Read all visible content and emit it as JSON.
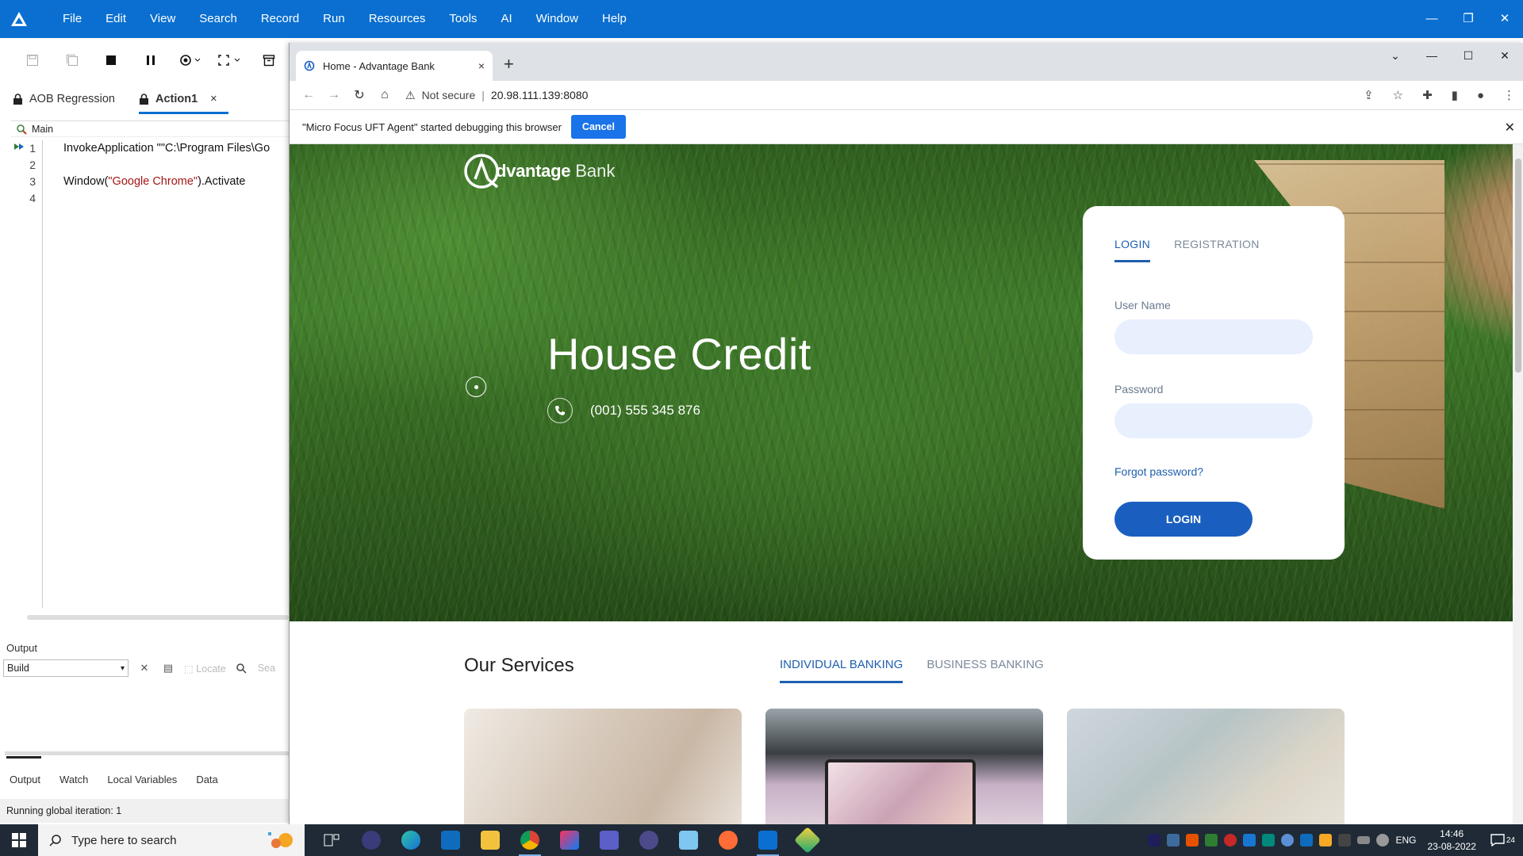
{
  "uft": {
    "menu": [
      "File",
      "Edit",
      "View",
      "Search",
      "Record",
      "Run",
      "Resources",
      "Tools",
      "AI",
      "Window",
      "Help"
    ],
    "doc_tabs": [
      {
        "label": "AOB Regression",
        "active": false
      },
      {
        "label": "Action1",
        "active": true,
        "close": "×"
      }
    ],
    "editor": {
      "breadcrumb": "Main",
      "line_numbers": [
        "1",
        "2",
        "3",
        "4"
      ],
      "line1_prefix": "InvokeApplication \"",
      "line1_string": "\"C:\\Program Files\\Go",
      "line3_prefix": "Window(",
      "line3_string": "\"Google Chrome\"",
      "line3_suffix": ").Activate"
    },
    "output": {
      "title": "Output",
      "select_value": "Build",
      "locate_label": "Locate",
      "search_placeholder": "Sea"
    },
    "bottom_tabs": [
      "Output",
      "Watch",
      "Local Variables",
      "Data"
    ],
    "status": "Running global iteration: 1"
  },
  "chrome": {
    "tab_title": "Home - Advantage Bank",
    "tab_close": "×",
    "new_tab": "+",
    "security_label": "Not secure",
    "url": "20.98.111.139:8080",
    "debug_message": "\"Micro Focus UFT Agent\" started debugging this browser",
    "debug_cancel": "Cancel"
  },
  "page": {
    "logo_name": "dvantage",
    "logo_suffix": "Bank",
    "hero_title": "House Credit",
    "phone": "(001) 555 345 876",
    "login": {
      "tab_login": "LOGIN",
      "tab_registration": "REGISTRATION",
      "username_label": "User Name",
      "password_label": "Password",
      "forgot": "Forgot password?",
      "button": "LOGIN"
    },
    "services_title": "Our Services",
    "services_tabs": [
      "INDIVIDUAL BANKING",
      "BUSINESS BANKING"
    ]
  },
  "taskbar": {
    "search_placeholder": "Type here to search",
    "language": "ENG",
    "time": "14:46",
    "date": "23-08-2022",
    "notification_count": "24"
  },
  "colors": {
    "uft_blue": "#0a6fd0",
    "bank_blue": "#1a5fbf",
    "taskbar": "#1f2a36"
  }
}
